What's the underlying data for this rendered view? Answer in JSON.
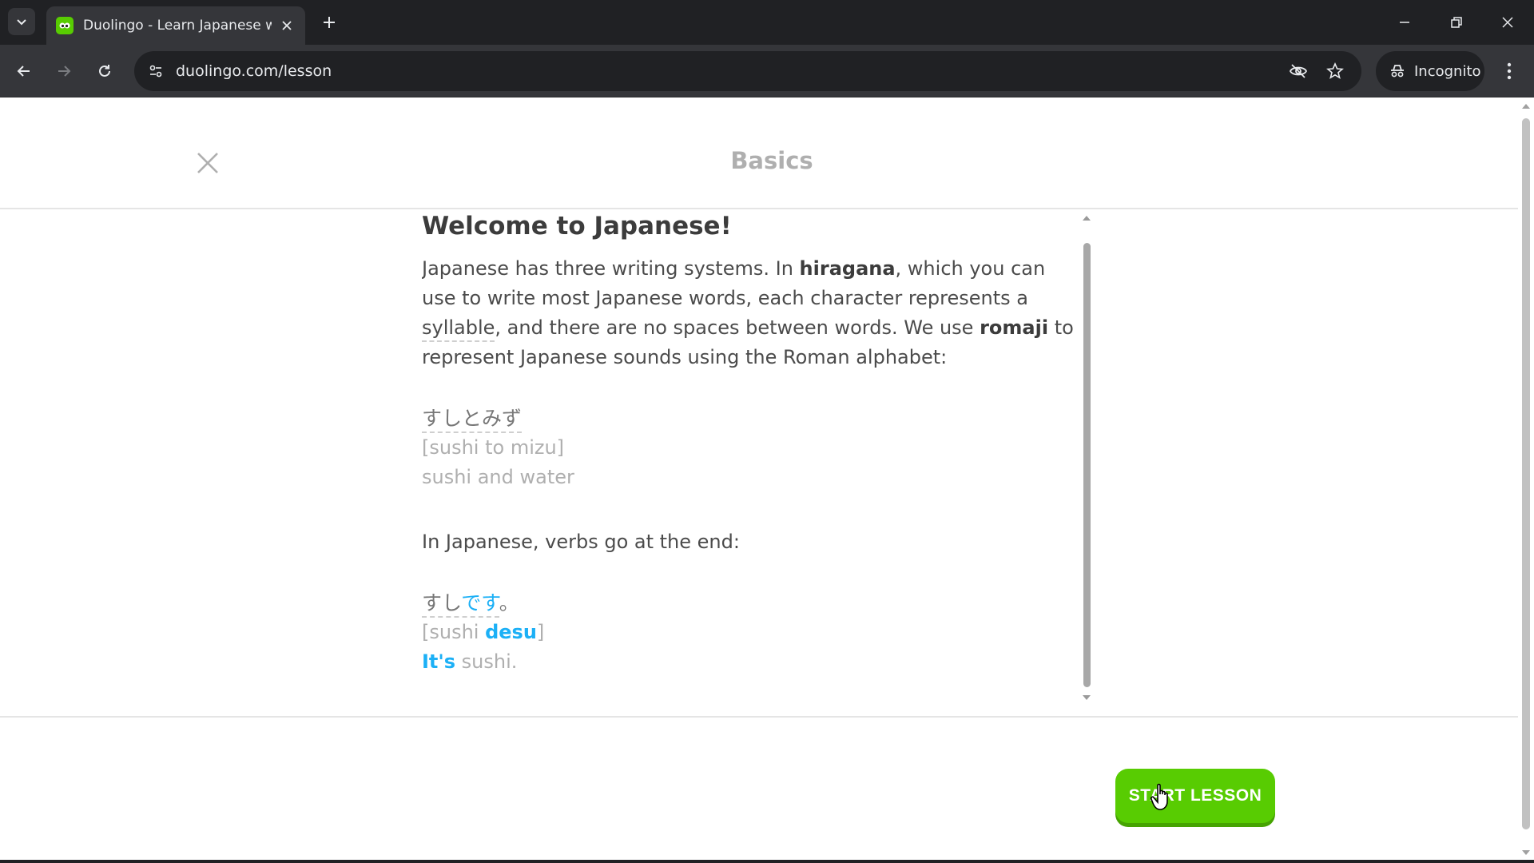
{
  "browser": {
    "tab_title": "Duolingo - Learn Japanese with",
    "url": "duolingo.com/lesson",
    "incognito_label": "Incognito",
    "icons": [
      "tab-search-icon",
      "duolingo-favicon",
      "close-icon",
      "plus-icon",
      "minimize-icon",
      "restore-icon",
      "window-close-icon",
      "back-arrow-icon",
      "forward-arrow-icon",
      "reload-icon",
      "site-settings-icon",
      "eye-off-icon",
      "star-icon",
      "incognito-icon",
      "more-vert-icon"
    ]
  },
  "lesson": {
    "header_title": "Basics",
    "heading": "Welcome to Japanese!",
    "intro": {
      "p1": "Japanese has three writing systems. In ",
      "hiragana": "hiragana",
      "p2": ", which you can use to write most Japanese words, each character represents a ",
      "syllable": "syllable",
      "p3": ", and there are no spaces between words. We use ",
      "romaji": "romaji",
      "p4": " to represent Japanese sounds using the Roman alphabet:"
    },
    "example1": {
      "japanese": "すしとみず",
      "romaji": "[sushi to mizu]",
      "english": "sushi and water"
    },
    "verbs_text": "In Japanese, verbs go at the end:",
    "example2": {
      "jp_plain": "すし",
      "jp_highlight": "です",
      "jp_end": "。",
      "romaji_open": "[sushi ",
      "romaji_highlight": "desu",
      "romaji_close": "]",
      "en_highlight": "It's",
      "en_rest": " sushi."
    },
    "start_button": "START LESSON"
  },
  "colors": {
    "brand_green": "#58cc02",
    "highlight_blue": "#1cb0f6"
  }
}
